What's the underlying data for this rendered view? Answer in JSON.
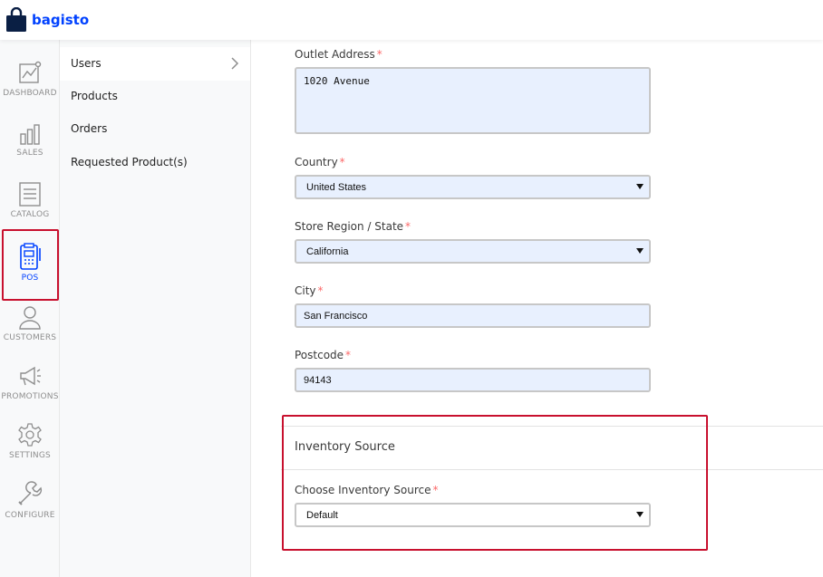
{
  "brand": {
    "name": "bagisto",
    "color": "#0041ff"
  },
  "nav": {
    "items": [
      {
        "label": "DASHBOARD",
        "icon": "dashboard-icon"
      },
      {
        "label": "SALES",
        "icon": "sales-icon"
      },
      {
        "label": "CATALOG",
        "icon": "catalog-icon"
      },
      {
        "label": "POS",
        "icon": "pos-icon",
        "active": true
      },
      {
        "label": "CUSTOMERS",
        "icon": "customers-icon"
      },
      {
        "label": "PROMOTIONS",
        "icon": "promotions-icon"
      },
      {
        "label": "SETTINGS",
        "icon": "settings-icon"
      },
      {
        "label": "CONFIGURE",
        "icon": "configure-icon"
      }
    ]
  },
  "subnav": {
    "items": [
      {
        "label": "Users",
        "active": true
      },
      {
        "label": "Products"
      },
      {
        "label": "Orders"
      },
      {
        "label": "Requested Product(s)"
      }
    ]
  },
  "form": {
    "outlet_address": {
      "label": "Outlet Address",
      "required": "*",
      "value": "1020 Avenue"
    },
    "country": {
      "label": "Country",
      "required": "*",
      "value": "United States"
    },
    "state": {
      "label": "Store Region / State",
      "required": "*",
      "value": "California"
    },
    "city": {
      "label": "City",
      "required": "*",
      "value": "San Francisco"
    },
    "postcode": {
      "label": "Postcode",
      "required": "*",
      "value": "94143"
    }
  },
  "inventory": {
    "title": "Inventory Source",
    "source": {
      "label": "Choose Inventory Source",
      "required": "*",
      "value": "Default"
    }
  },
  "colors": {
    "highlight": "#c8102e",
    "required": "#fc6868",
    "field_bg": "#e8f0fe"
  }
}
